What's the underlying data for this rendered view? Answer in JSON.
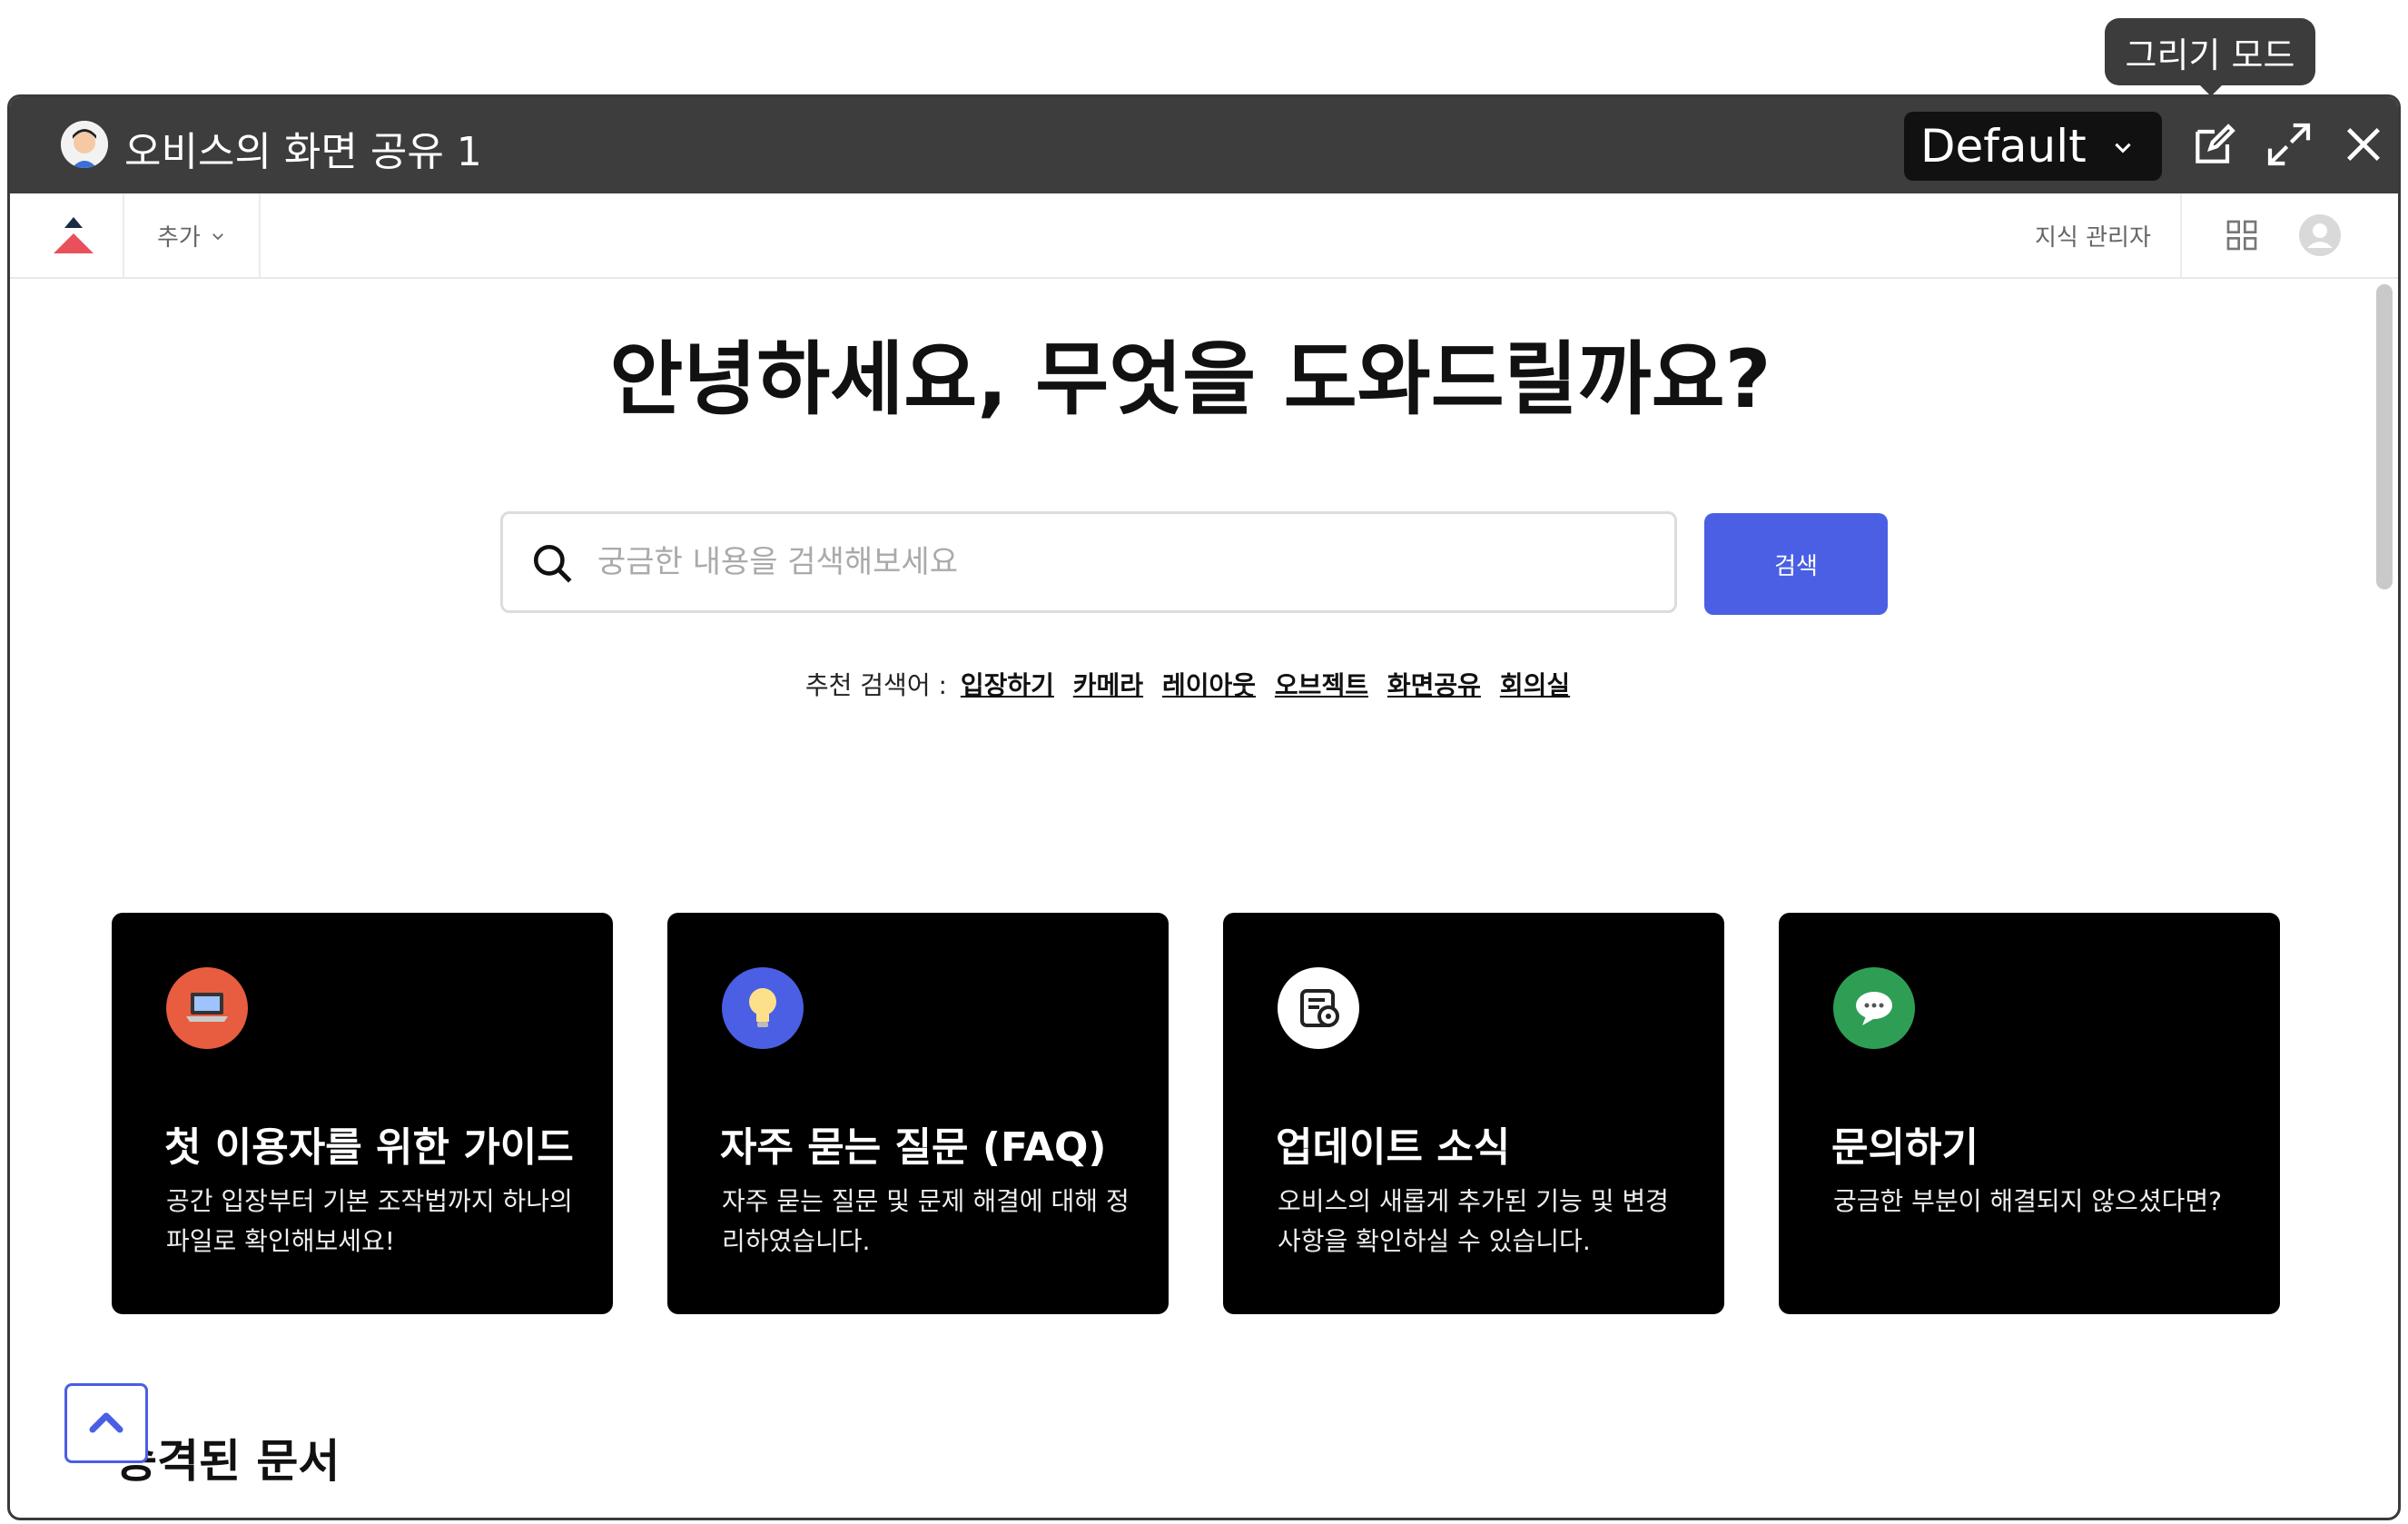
{
  "tooltip": {
    "label": "그리기 모드"
  },
  "window": {
    "title": "오비스의 화면 공유 1",
    "layout_select": "Default"
  },
  "nav": {
    "add_label": "추가",
    "admin_label": "지식 관리자"
  },
  "hero": {
    "heading": "안녕하세요, 무엇을 도와드릴까요?"
  },
  "search": {
    "placeholder": "궁금한 내용을 검색해보세요",
    "button_label": "검색"
  },
  "suggestions": {
    "prefix": "추천 검색어 :",
    "items": [
      "입장하기",
      "카메라",
      "레이아웃",
      "오브젝트",
      "화면공유",
      "회의실"
    ]
  },
  "cards": [
    {
      "icon": "laptop-icon",
      "color": "#e85c3f",
      "title": "첫 이용자를 위한 가이드",
      "desc": "공간 입장부터 기본 조작법까지 하나의 파일로 확인해보세요!"
    },
    {
      "icon": "lightbulb-icon",
      "color": "#4a5fe4",
      "title": "자주 묻는 질문 (FAQ)",
      "desc": "자주 묻는 질문 및 문제 해결에 대해 정리하였습니다."
    },
    {
      "icon": "update-icon",
      "color": "#ffffff",
      "title": "업데이트 소식",
      "desc": "오비스의 새롭게 추가된 기능 및 변경 사항을 확인하실 수 있습니다."
    },
    {
      "icon": "chat-bubble-icon",
      "color": "#2e9e55",
      "title": "문의하기",
      "desc": "궁금한 부분이 해결되지 않으셨다면?"
    }
  ],
  "section": {
    "title": "승격된 문서"
  }
}
